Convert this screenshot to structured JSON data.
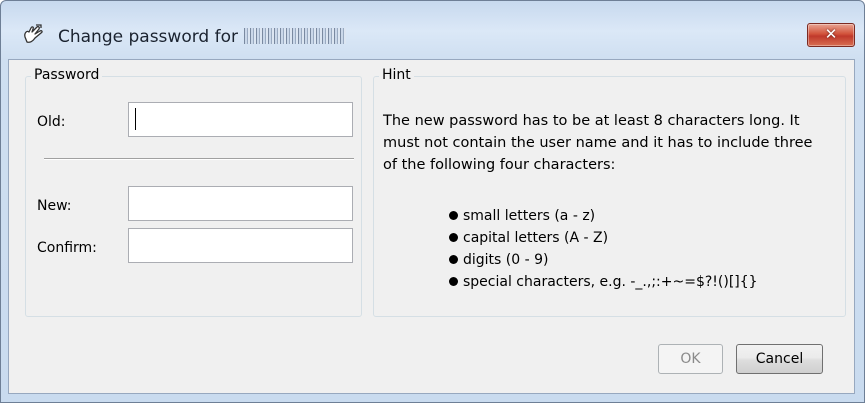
{
  "window": {
    "title": "Change password for",
    "close_label": "✕"
  },
  "password_group": {
    "legend": "Password",
    "old_label": "Old:",
    "new_label": "New:",
    "confirm_label": "Confirm:",
    "old_value": "",
    "new_value": "",
    "confirm_value": ""
  },
  "hint_group": {
    "legend": "Hint",
    "text": "The new password has to be at least 8 characters long. It must not contain the user name and it has to include three of the following four characters:",
    "bullets": [
      "small letters (a - z)",
      "capital letters (A - Z)",
      "digits (0 - 9)",
      "special characters, e.g. -_.,;:+~=$?!()[]{}"
    ]
  },
  "buttons": {
    "ok": "OK",
    "cancel": "Cancel"
  },
  "icons": {
    "app": "hand-key-icon",
    "close": "close-icon"
  },
  "colors": {
    "close_button": "#c7452f",
    "title_bar": "#cfdff1",
    "client_background": "#f0f0f0"
  }
}
